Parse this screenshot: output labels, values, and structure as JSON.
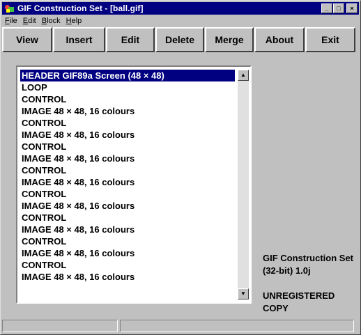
{
  "window": {
    "title": "GIF Construction Set - [ball.gif]"
  },
  "menu": [
    {
      "label": "File"
    },
    {
      "label": "Edit"
    },
    {
      "label": "Block"
    },
    {
      "label": "Help"
    }
  ],
  "toolbar": {
    "buttons": [
      {
        "label": "View"
      },
      {
        "label": "Insert"
      },
      {
        "label": "Edit"
      },
      {
        "label": "Delete"
      },
      {
        "label": "Merge"
      },
      {
        "label": "About"
      },
      {
        "label": "Exit"
      }
    ]
  },
  "blocks": [
    {
      "label": "HEADER GIF89a Screen (48 × 48)",
      "selected": true
    },
    {
      "label": "LOOP"
    },
    {
      "label": "CONTROL"
    },
    {
      "label": "IMAGE 48 × 48, 16 colours"
    },
    {
      "label": "CONTROL"
    },
    {
      "label": "IMAGE 48 × 48, 16 colours"
    },
    {
      "label": "CONTROL"
    },
    {
      "label": "IMAGE 48 × 48, 16 colours"
    },
    {
      "label": "CONTROL"
    },
    {
      "label": "IMAGE 48 × 48, 16 colours"
    },
    {
      "label": "CONTROL"
    },
    {
      "label": "IMAGE 48 × 48, 16 colours"
    },
    {
      "label": "CONTROL"
    },
    {
      "label": "IMAGE 48 × 48, 16 colours"
    },
    {
      "label": "CONTROL"
    },
    {
      "label": "IMAGE 48 × 48, 16 colours"
    },
    {
      "label": "CONTROL"
    },
    {
      "label": "IMAGE 48 × 48, 16 colours"
    }
  ],
  "info": {
    "version": "GIF Construction Set (32-bit) 1.0j",
    "registration": "UNREGISTERED COPY"
  },
  "colors": {
    "title_bar": "#000080",
    "selection": "#000080",
    "face": "#c0c0c0"
  }
}
